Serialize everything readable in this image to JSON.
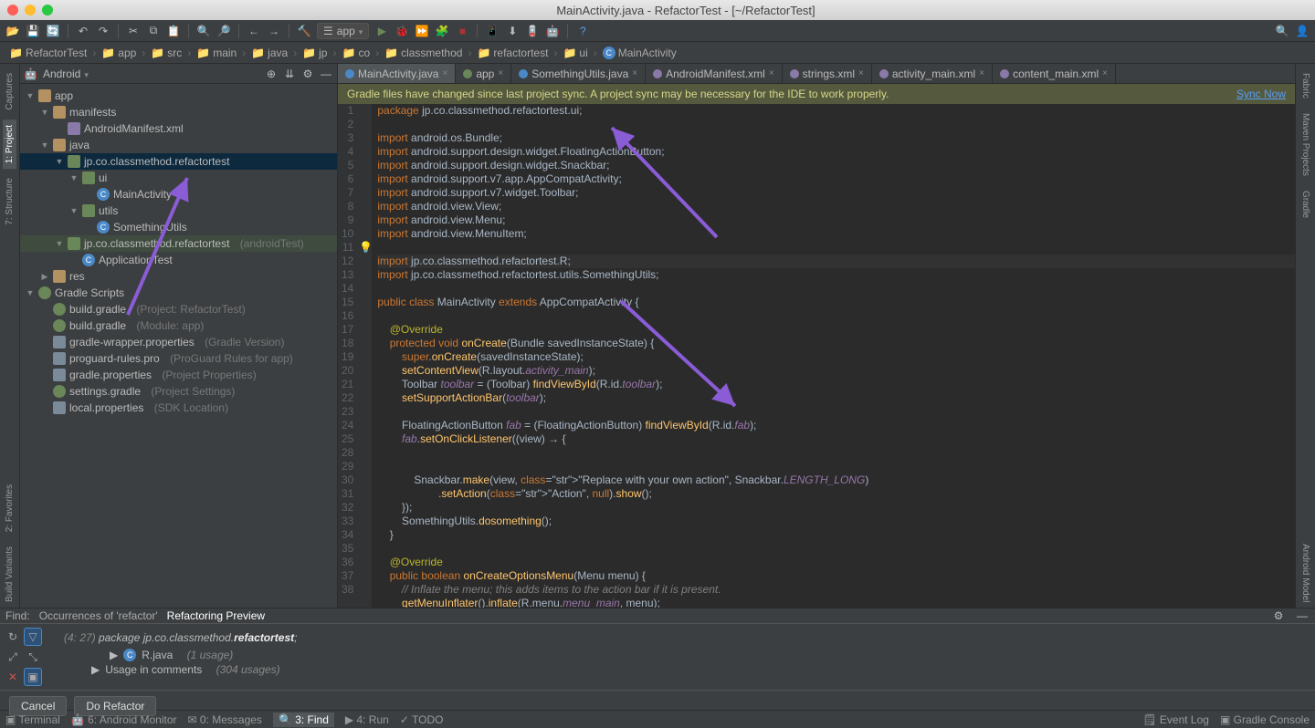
{
  "title": "MainActivity.java - RefactorTest - [~/RefactorTest]",
  "run_config": "app",
  "breadcrumb": [
    "RefactorTest",
    "app",
    "src",
    "main",
    "java",
    "jp",
    "co",
    "classmethod",
    "refactortest",
    "ui",
    "MainActivity"
  ],
  "project_mode": "Android",
  "tree": {
    "root": "app",
    "manifests": "manifests",
    "manifest_file": "AndroidManifest.xml",
    "java": "java",
    "pkg_main": "jp.co.classmethod.refactortest",
    "pkg_ui": "ui",
    "cls_main": "MainActivity",
    "pkg_utils": "utils",
    "cls_utils": "SomethingUtils",
    "pkg_test": "jp.co.classmethod.refactortest",
    "pkg_test_note": "(androidTest)",
    "cls_test": "ApplicationTest",
    "res": "res",
    "scripts": "Gradle Scripts",
    "scripts_items": [
      {
        "name": "build.gradle",
        "note": "(Project: RefactorTest)"
      },
      {
        "name": "build.gradle",
        "note": "(Module: app)"
      },
      {
        "name": "gradle-wrapper.properties",
        "note": "(Gradle Version)"
      },
      {
        "name": "proguard-rules.pro",
        "note": "(ProGuard Rules for app)"
      },
      {
        "name": "gradle.properties",
        "note": "(Project Properties)"
      },
      {
        "name": "settings.gradle",
        "note": "(Project Settings)"
      },
      {
        "name": "local.properties",
        "note": "(SDK Location)"
      }
    ]
  },
  "tabs": [
    {
      "label": "MainActivity.java",
      "icon": "blue",
      "active": true
    },
    {
      "label": "app",
      "icon": "green"
    },
    {
      "label": "SomethingUtils.java",
      "icon": "blue"
    },
    {
      "label": "AndroidManifest.xml",
      "icon": "xml"
    },
    {
      "label": "strings.xml",
      "icon": "xml"
    },
    {
      "label": "activity_main.xml",
      "icon": "xml"
    },
    {
      "label": "content_main.xml",
      "icon": "xml"
    }
  ],
  "banner": {
    "text": "Gradle files have changed since last project sync. A project sync may be necessary for the IDE to work properly.",
    "action": "Sync Now"
  },
  "code_lines": [
    "package jp.co.classmethod.refactortest.ui;",
    "",
    "import android.os.Bundle;",
    "import android.support.design.widget.FloatingActionButton;",
    "import android.support.design.widget.Snackbar;",
    "import android.support.v7.app.AppCompatActivity;",
    "import android.support.v7.widget.Toolbar;",
    "import android.view.View;",
    "import android.view.Menu;",
    "import android.view.MenuItem;",
    "",
    "import jp.co.classmethod.refactortest.R;",
    "import jp.co.classmethod.refactortest.utils.SomethingUtils;",
    "",
    "public class MainActivity extends AppCompatActivity {",
    "",
    "    @Override",
    "    protected void onCreate(Bundle savedInstanceState) {",
    "        super.onCreate(savedInstanceState);",
    "        setContentView(R.layout.activity_main);",
    "        Toolbar toolbar = (Toolbar) findViewById(R.id.toolbar);",
    "        setSupportActionBar(toolbar);",
    "",
    "        FloatingActionButton fab = (FloatingActionButton) findViewById(R.id.fab);",
    "        fab.setOnClickListener((view) → {",
    "",
    "",
    "            Snackbar.make(view, \"Replace with your own action\", Snackbar.LENGTH_LONG)",
    "                    .setAction(\"Action\", null).show();",
    "        });",
    "        SomethingUtils.dosomething();",
    "    }",
    "",
    "    @Override",
    "    public boolean onCreateOptionsMenu(Menu menu) {",
    "        // Inflate the menu; this adds items to the action bar if it is present.",
    "        getMenuInflater().inflate(R.menu.menu_main, menu);"
  ],
  "line_numbers_visible": "1-38 (26/27 merged)",
  "find": {
    "title": "Find:",
    "tabs": [
      "Occurrences of 'refactor'",
      "Refactoring Preview"
    ],
    "summary_pos": "(4: 27)",
    "summary_text": "package jp.co.classmethod.",
    "summary_bold": "refactortest",
    "summary_suffix": ";",
    "row1": "R.java",
    "row1_note": "(1 usage)",
    "row2": "Usage in comments",
    "row2_note": "(304 usages)",
    "cancel": "Cancel",
    "do_refactor": "Do Refactor"
  },
  "left_tabs": [
    "Captures",
    "1: Project",
    "7: Structure",
    "2: Favorites",
    "Build Variants"
  ],
  "right_tabs": [
    "Fabric",
    "Maven Projects",
    "Gradle",
    "Android Model"
  ],
  "status_items": [
    "Terminal",
    "6: Android Monitor",
    "0: Messages",
    "3: Find",
    "4: Run",
    "TODO"
  ],
  "status_right": [
    "Event Log",
    "Gradle Console"
  ]
}
